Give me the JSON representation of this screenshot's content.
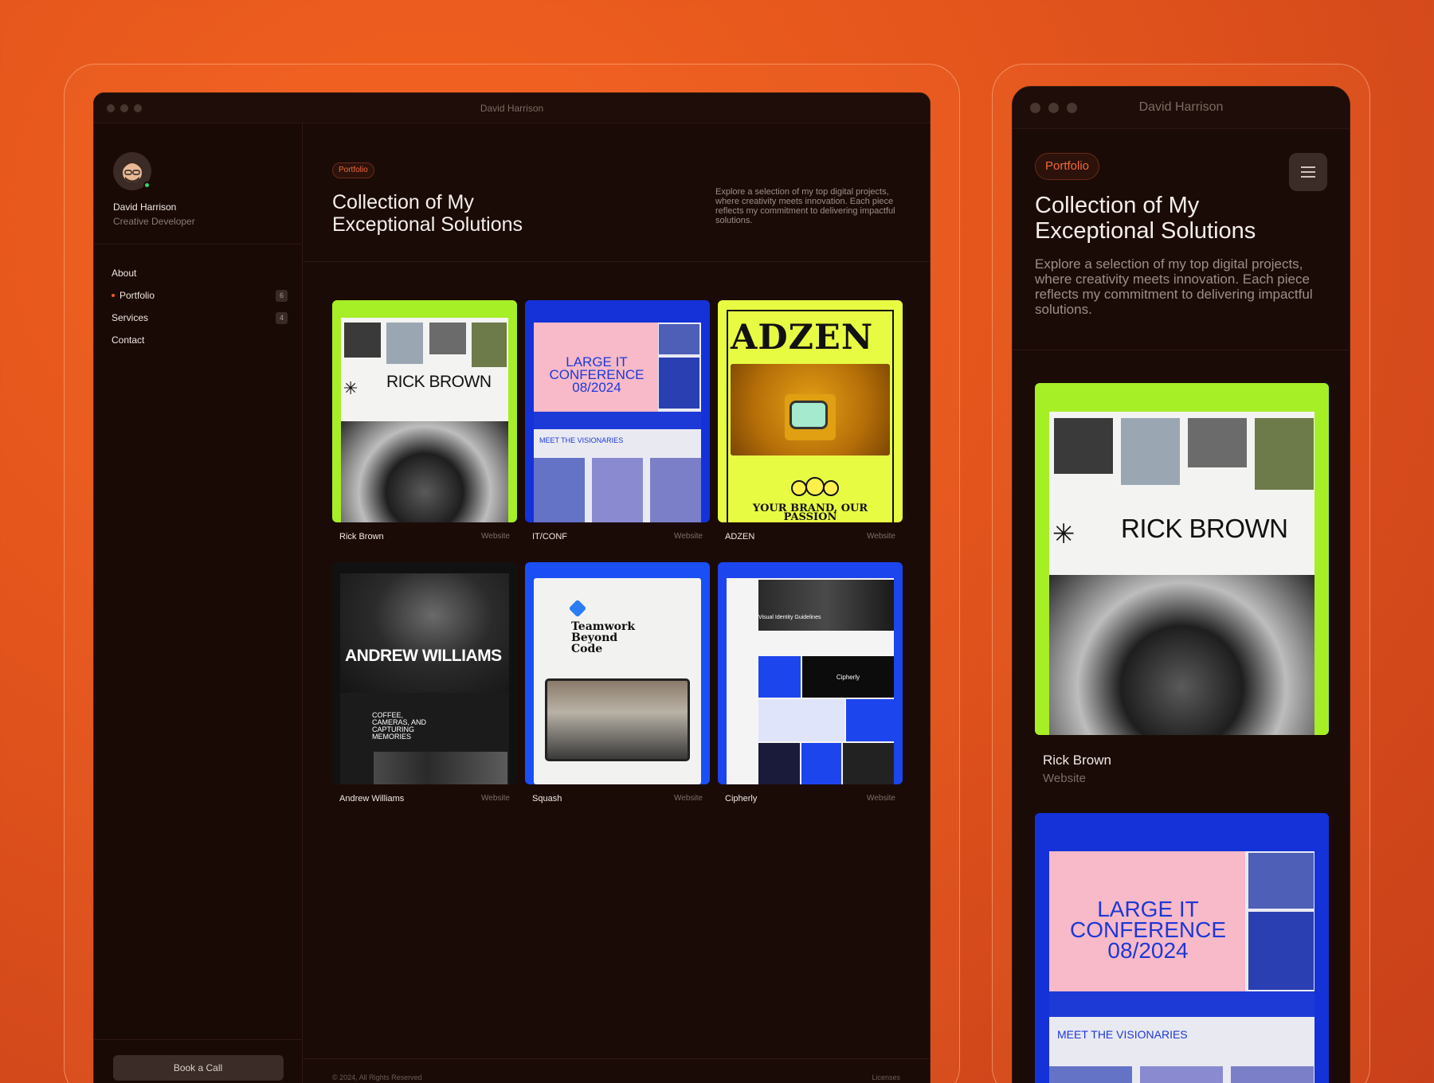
{
  "window": {
    "title": "David Harrison"
  },
  "profile": {
    "name": "David Harrison",
    "role": "Creative Developer"
  },
  "nav": {
    "items": [
      {
        "label": "About",
        "count": ""
      },
      {
        "label": "Portfolio",
        "count": "6",
        "active": true
      },
      {
        "label": "Services",
        "count": "4"
      },
      {
        "label": "Contact",
        "count": ""
      }
    ]
  },
  "sidebar": {
    "cta": "Book a Call"
  },
  "header": {
    "badge": "Portfolio",
    "title": "Collection of My Exceptional Solutions",
    "description": "Explore a selection of my top digital projects, where creativity meets innovation. Each piece reflects my commitment to delivering impactful solutions."
  },
  "projects": [
    {
      "name": "Rick Brown",
      "type": "Website",
      "art": "RICK BROWN"
    },
    {
      "name": "IT/CONF",
      "type": "Website",
      "art": "LARGE IT CONFERENCE 08/2024",
      "art2": "MEET THE VISIONARIES"
    },
    {
      "name": "ADZEN",
      "type": "Website",
      "art": "ADZEN",
      "art2": "YOUR BRAND, OUR PASSION"
    },
    {
      "name": "Andrew Williams",
      "type": "Website",
      "art": "ANDREW WILLIAMS",
      "art2": "COFFEE, CAMERAS, AND CAPTURING MEMORIES"
    },
    {
      "name": "Squash",
      "type": "Website",
      "art": "Teamwork Beyond Code"
    },
    {
      "name": "Cipherly",
      "type": "Website",
      "art": "Visual Identity Guidelines",
      "art2": "Cipherly"
    }
  ],
  "footer": {
    "copyright": "© 2024, All Rights Reserved",
    "link": "Licenses"
  },
  "colors": {
    "accent": "#f05a25",
    "background": "#1b0b07",
    "frame": "#e2541c"
  },
  "icons": {
    "menu": "hamburger-menu-icon",
    "active_nav": "bullet-dot-icon"
  }
}
